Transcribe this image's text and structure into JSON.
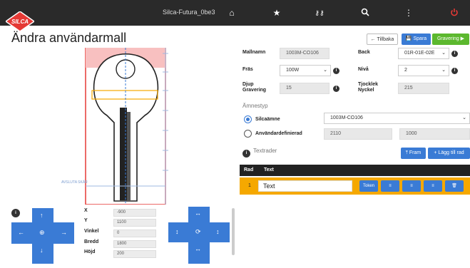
{
  "app": {
    "title": "Silca-Futura_0be3"
  },
  "header": {
    "logo_text": "SILCA"
  },
  "page": {
    "title": "Ändra användarmall"
  },
  "actions": {
    "back": "Tillbaka",
    "save": "Spara",
    "engrave": "Gravering"
  },
  "preview": {
    "annotation": "AVSLUTA SKÄR"
  },
  "form": {
    "template_name_label": "Mallnamn",
    "template_name_value": "1003M-CO106",
    "back_label": "Back",
    "back_value": "01R-01E-02E",
    "cutter_label": "Fräs",
    "cutter_value": "100W",
    "level_label": "Nivå",
    "level_value": "2",
    "depth_label": "Djup Gravering",
    "depth_value": "15",
    "thickness_label": "Tjocklek Nyckel",
    "thickness_value": "215"
  },
  "blank": {
    "section": "Ämnestyp",
    "silca_label": "Silcaämne",
    "silca_value": "1003M-CO106",
    "user_label": "Användardefinierad",
    "user_value_1": "2110",
    "user_value_2": "1000"
  },
  "textrows": {
    "section": "Textrader",
    "forward": "Fram",
    "add_row": "Lägg till rad",
    "col_row": "Rad",
    "col_text": "Text",
    "rows": [
      {
        "index": "1",
        "text": "Text",
        "token_label": "Token"
      }
    ]
  },
  "coords": {
    "x_label": "X",
    "x_value": "-900",
    "y_label": "Y",
    "y_value": "1100",
    "angle_label": "Vinkel",
    "angle_value": "0",
    "width_label": "Bredd",
    "width_value": "1800",
    "height_label": "Höjd",
    "height_value": "200"
  },
  "colors": {
    "accent": "#3a7bd5",
    "green": "#5cb82e",
    "highlight": "#f5a800",
    "alert": "#e53935"
  }
}
